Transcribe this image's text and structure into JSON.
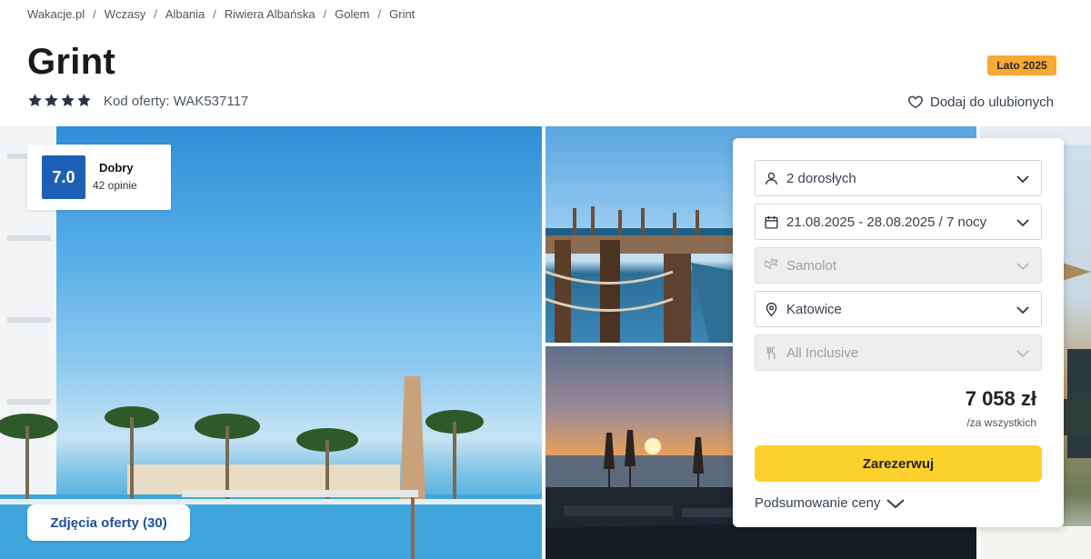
{
  "breadcrumb": {
    "items": [
      "Wakacje.pl",
      "Wczasy",
      "Albania",
      "Riwiera Albańska",
      "Golem",
      "Grint"
    ],
    "separator": "/"
  },
  "hotel": {
    "name": "Grint",
    "stars": 4,
    "offer_code": "Kod oferty: WAK537117",
    "season_badge": "Lato 2025",
    "favorite_label": "Dodaj do ulubionych"
  },
  "rating": {
    "score": "7.0",
    "label": "Dobry",
    "count": "42 opinie"
  },
  "gallery": {
    "photos_button": "Zdjęcia oferty (30)"
  },
  "booking": {
    "travelers": "2 dorosłych",
    "dates": "21.08.2025 - 28.08.2025 / 7 nocy",
    "transport": "Samolot",
    "departure": "Katowice",
    "board": "All Inclusive",
    "price": "7 058 zł",
    "price_note": "/za wszystkich",
    "book_button": "Zarezerwuj",
    "summary_link": "Podsumowanie ceny"
  },
  "colors": {
    "rating_badge": "#1d5fb4",
    "season_badge": "#f6a933",
    "book_button": "#fdd12c",
    "photos_button_text": "#1d4fa0"
  },
  "icons": {
    "stars": "star-icon",
    "favorite": "heart-icon",
    "travelers": "person-icon",
    "dates": "calendar-icon",
    "transport": "plane-icon",
    "departure": "location-pin-icon",
    "board": "cutlery-icon",
    "dropdown": "chevron-down-icon"
  }
}
